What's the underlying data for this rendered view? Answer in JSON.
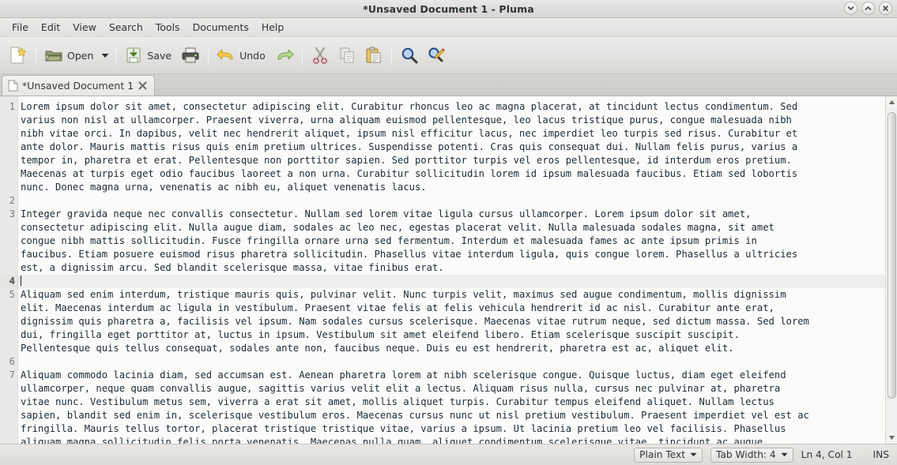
{
  "window": {
    "title": "*Unsaved Document 1 - Pluma",
    "buttons": [
      {
        "name": "minimize-button",
        "icon": "chevron-down-icon"
      },
      {
        "name": "maximize-button",
        "icon": "chevron-up-icon"
      },
      {
        "name": "close-button",
        "icon": "close-icon"
      }
    ]
  },
  "menubar": {
    "items": [
      "File",
      "Edit",
      "View",
      "Search",
      "Tools",
      "Documents",
      "Help"
    ]
  },
  "toolbar": {
    "new_label": "",
    "open_label": "Open",
    "save_label": "Save",
    "print_label": "",
    "undo_label": "Undo",
    "redo_label": "",
    "cut_label": "",
    "copy_label": "",
    "paste_label": "",
    "find_label": "",
    "replace_label": ""
  },
  "tabs": [
    {
      "label": "*Unsaved Document 1",
      "close": "✖"
    }
  ],
  "editor": {
    "lines": [
      {
        "num": "1",
        "text": "Lorem ipsum dolor sit amet, consectetur adipiscing elit. Curabitur rhoncus leo ac magna placerat, at tincidunt lectus condimentum. Sed",
        "current": false
      },
      {
        "num": "",
        "text": "varius non nisl at ullamcorper. Praesent viverra, urna aliquam euismod pellentesque, leo lacus tristique purus, congue malesuada nibh",
        "current": false
      },
      {
        "num": "",
        "text": "nibh vitae orci. In dapibus, velit nec hendrerit aliquet, ipsum nisl efficitur lacus, nec imperdiet leo turpis sed risus. Curabitur et",
        "current": false
      },
      {
        "num": "",
        "text": "ante dolor. Mauris mattis risus quis enim pretium ultrices. Suspendisse potenti. Cras quis consequat dui. Nullam felis purus, varius a",
        "current": false
      },
      {
        "num": "",
        "text": "tempor in, pharetra et erat. Pellentesque non porttitor sapien. Sed porttitor turpis vel eros pellentesque, id interdum eros pretium.",
        "current": false
      },
      {
        "num": "",
        "text": "Maecenas at turpis eget odio faucibus laoreet a non urna. Curabitur sollicitudin lorem id ipsum malesuada faucibus. Etiam sed lobortis",
        "current": false
      },
      {
        "num": "",
        "text": "nunc. Donec magna urna, venenatis ac nibh eu, aliquet venenatis lacus.",
        "current": false
      },
      {
        "num": "2",
        "text": "",
        "current": false
      },
      {
        "num": "3",
        "text": "Integer gravida neque nec convallis consectetur. Nullam sed lorem vitae ligula cursus ullamcorper. Lorem ipsum dolor sit amet,",
        "current": false
      },
      {
        "num": "",
        "text": "consectetur adipiscing elit. Nulla augue diam, sodales ac leo nec, egestas placerat velit. Nulla malesuada sodales magna, sit amet",
        "current": false
      },
      {
        "num": "",
        "text": "congue nibh mattis sollicitudin. Fusce fringilla ornare urna sed fermentum. Interdum et malesuada fames ac ante ipsum primis in",
        "current": false
      },
      {
        "num": "",
        "text": "faucibus. Etiam posuere euismod risus pharetra sollicitudin. Phasellus vitae interdum ligula, quis congue lorem. Phasellus a ultricies",
        "current": false
      },
      {
        "num": "",
        "text": "est, a dignissim arcu. Sed blandit scelerisque massa, vitae finibus erat.",
        "current": false
      },
      {
        "num": "4",
        "text": "",
        "current": true
      },
      {
        "num": "5",
        "text": "Aliquam sed enim interdum, tristique mauris quis, pulvinar velit. Nunc turpis velit, maximus sed augue condimentum, mollis dignissim",
        "current": false
      },
      {
        "num": "",
        "text": "elit. Maecenas interdum ac ligula in vestibulum. Praesent vitae felis at felis vehicula hendrerit id ac nisl. Curabitur ante erat,",
        "current": false
      },
      {
        "num": "",
        "text": "dignissim quis pharetra a, facilisis vel ipsum. Nam sodales cursus scelerisque. Maecenas vitae rutrum neque, sed dictum massa. Sed lorem",
        "current": false
      },
      {
        "num": "",
        "text": "dui, fringilla eget porttitor at, luctus in ipsum. Vestibulum sit amet eleifend libero. Etiam scelerisque suscipit suscipit.",
        "current": false
      },
      {
        "num": "",
        "text": "Pellentesque quis tellus consequat, sodales ante non, faucibus neque. Duis eu est hendrerit, pharetra est ac, aliquet elit.",
        "current": false
      },
      {
        "num": "6",
        "text": "",
        "current": false
      },
      {
        "num": "7",
        "text": "Aliquam commodo lacinia diam, sed accumsan est. Aenean pharetra lorem at nibh scelerisque congue. Quisque luctus, diam eget eleifend",
        "current": false
      },
      {
        "num": "",
        "text": "ullamcorper, neque quam convallis augue, sagittis varius velit elit a lectus. Aliquam risus nulla, cursus nec pulvinar at, pharetra",
        "current": false
      },
      {
        "num": "",
        "text": "vitae nunc. Vestibulum metus sem, viverra a erat sit amet, mollis aliquet turpis. Curabitur tempus eleifend aliquet. Nullam lectus",
        "current": false
      },
      {
        "num": "",
        "text": "sapien, blandit sed enim in, scelerisque vestibulum eros. Maecenas cursus nunc ut nisl pretium vestibulum. Praesent imperdiet vel est ac",
        "current": false
      },
      {
        "num": "",
        "text": "fringilla. Mauris tellus tortor, placerat tristique tristique vitae, varius a ipsum. Ut lacinia pretium leo vel facilisis. Phasellus",
        "current": false
      },
      {
        "num": "",
        "text": "aliquam magna sollicitudin felis porta venenatis. Maecenas nulla quam, aliquet condimentum scelerisque vitae, tincidunt ac augue.",
        "current": false
      }
    ]
  },
  "statusbar": {
    "language": "Plain Text",
    "tab_width": "Tab Width: 4",
    "position": "Ln 4, Col 1",
    "insert_mode": "INS"
  },
  "colors": {
    "accent": "#3465a4",
    "text": "#1b2b34",
    "chrome": "#e4e2e0"
  }
}
